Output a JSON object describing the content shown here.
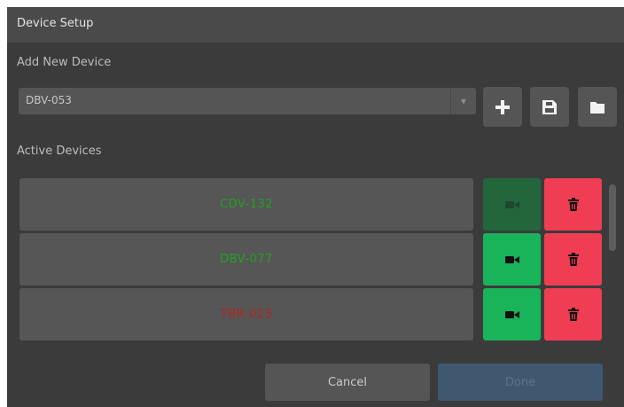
{
  "dialog": {
    "title": "Device Setup",
    "add_section_label": "Add New Device",
    "active_section_label": "Active Devices"
  },
  "device_select": {
    "value": "DBV-053",
    "icon": "chevron-down-icon"
  },
  "toolbar": {
    "add_icon": "plus-icon",
    "save_icon": "floppy-disk-icon",
    "open_icon": "folder-icon"
  },
  "devices": [
    {
      "name": "CDV-132",
      "name_color": "#1fa31f",
      "camera_active": false
    },
    {
      "name": "DBV-077",
      "name_color": "#1fa31f",
      "camera_active": true
    },
    {
      "name": "TBR-023",
      "name_color": "#b52323",
      "camera_active": true
    }
  ],
  "footer": {
    "cancel_label": "Cancel",
    "done_label": "Done"
  },
  "colors": {
    "camera_active": "#19b35a",
    "camera_inactive": "#24663c",
    "delete": "#ef3d54",
    "done_button": "#3f5870"
  }
}
